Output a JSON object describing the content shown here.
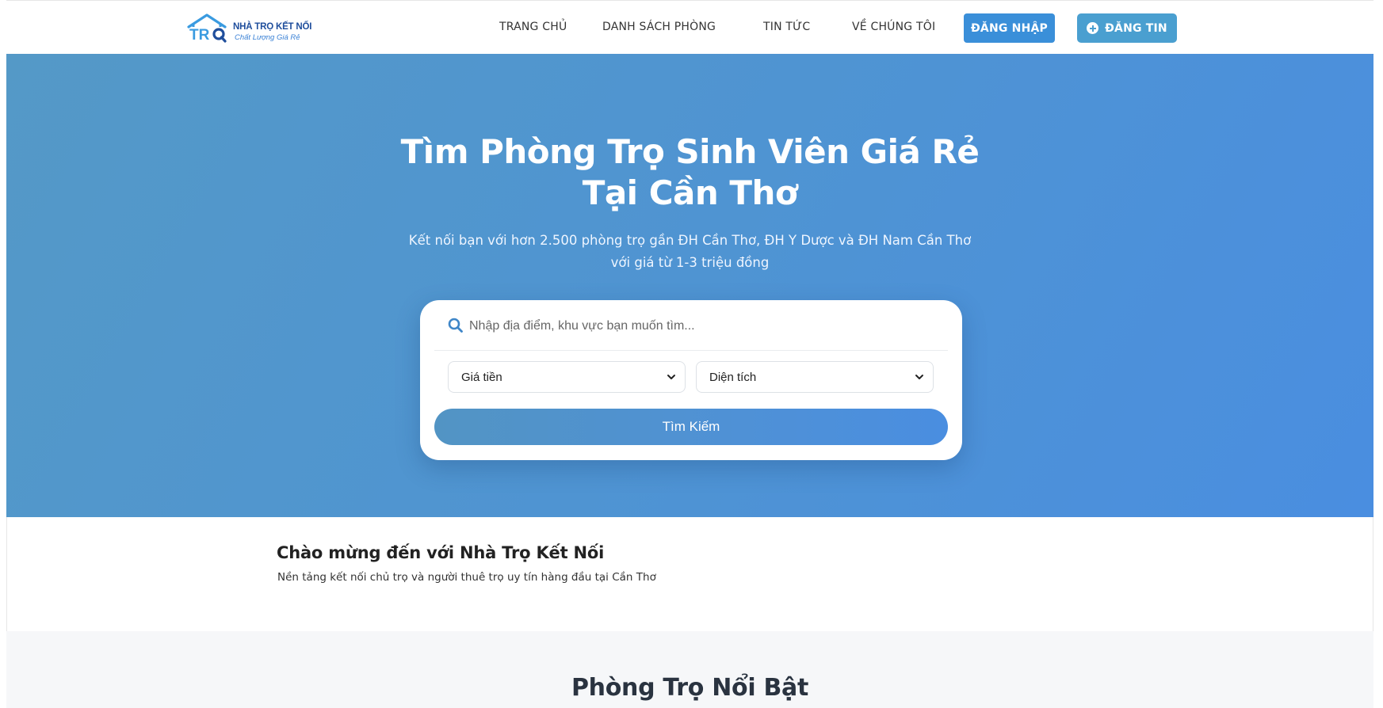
{
  "logo": {
    "mark_text": "TR",
    "title": "NHÀ TRỌ KẾT NỐI",
    "slogan": "Chất Lượng Giá Rẻ"
  },
  "nav": {
    "items": [
      {
        "label": "TRANG CHỦ"
      },
      {
        "label": "DANH SÁCH PHÒNG"
      },
      {
        "label": "TIN TỨC"
      },
      {
        "label": "VỀ CHÚNG TÔI"
      }
    ],
    "login_label": "ĐĂNG NHẬP",
    "post_label": "ĐĂNG TIN",
    "post_icon": "plus-circle-icon"
  },
  "hero": {
    "title_line1": "Tìm Phòng Trọ Sinh Viên Giá Rẻ",
    "title_line2": "Tại Cần Thơ",
    "subtitle_line1": "Kết nối bạn với hơn 2.500 phòng trọ gần ĐH Cần Thơ, ĐH Y Dược và ĐH Nam Cần Thơ",
    "subtitle_line2": "với giá từ 1-3 triệu đồng",
    "background_from": "#5499c7",
    "background_to": "#4a8ee0"
  },
  "search": {
    "icon": "search-icon",
    "value": "",
    "placeholder": "Nhập địa điểm, khu vực bạn muốn tìm...",
    "price_select": "Giá tiền",
    "area_select": "Diện tích",
    "button_label": "Tìm Kiếm"
  },
  "welcome": {
    "title": "Chào mừng đến với Nhà Trọ Kết Nối",
    "subtitle": "Nền tảng kết nối chủ trọ và người thuê trọ uy tín hàng đầu tại Cần Thơ"
  },
  "featured": {
    "title": "Phòng Trọ Nổi Bật"
  },
  "colors": {
    "accent": "#3a8fd9",
    "post_button": "#4a9fd0",
    "logo_text": "#1f4e9c"
  }
}
